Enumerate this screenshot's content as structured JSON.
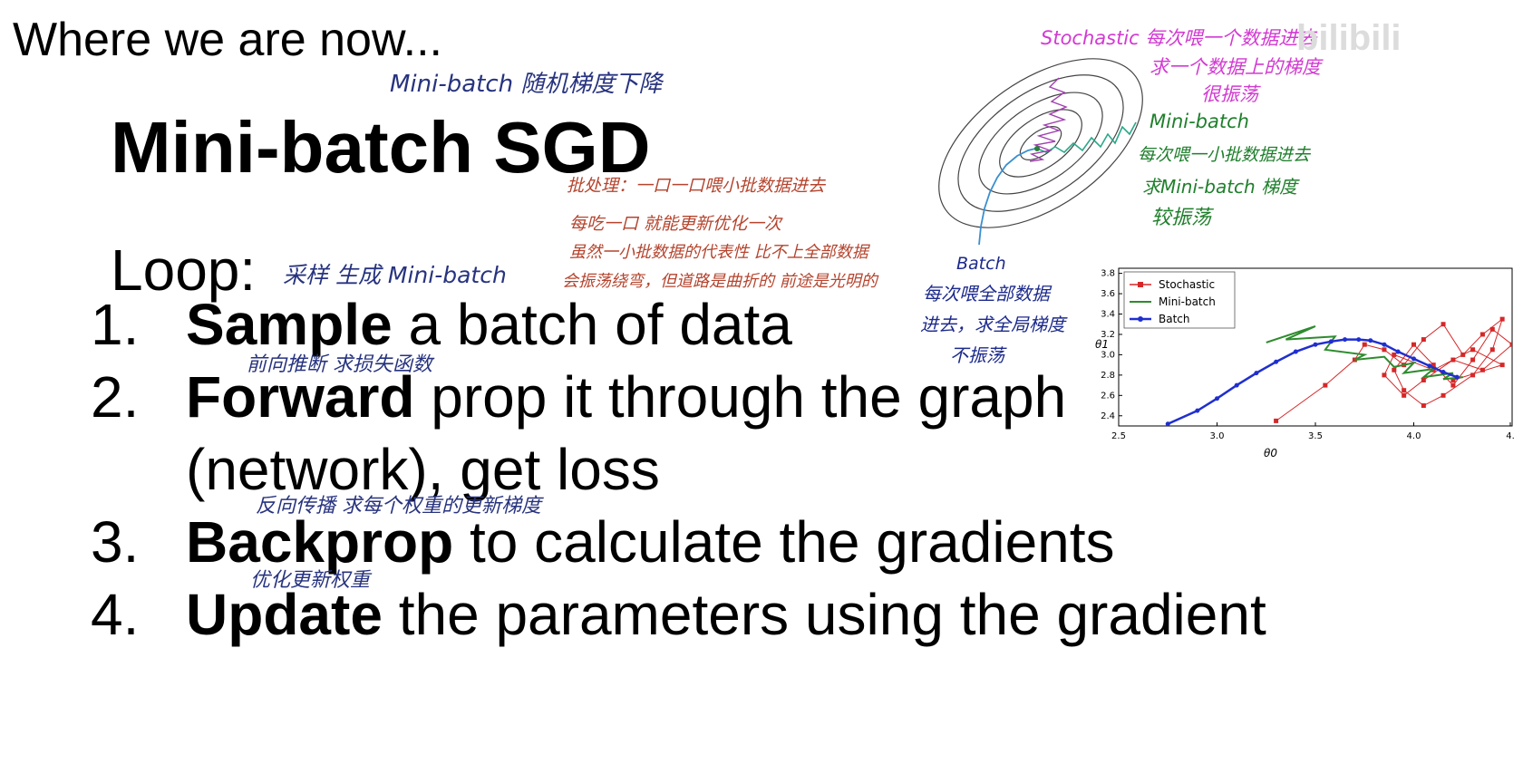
{
  "slide": {
    "header": "Where we are now...",
    "title": "Mini-batch SGD",
    "loop_label": "Loop:",
    "steps": [
      {
        "num": "1.",
        "bold": "Sample",
        "rest": " a batch of data"
      },
      {
        "num": "2.",
        "bold": "Forward",
        "rest": " prop it through the graph"
      },
      {
        "num": "",
        "bold": "",
        "rest": "(network), get loss"
      },
      {
        "num": "3.",
        "bold": "Backprop",
        "rest": " to calculate the gradients"
      },
      {
        "num": "4.",
        "bold": "Update",
        "rest": " the parameters using the gradient"
      }
    ]
  },
  "annotations": {
    "title_note": "Mini-batch 随机梯度下降",
    "red_1": "批处理：一口一口喂小批数据进去",
    "red_2": "每吃一口 就能更新优化一次",
    "red_3": "虽然一小批数据的代表性 比不上全部数据",
    "red_4": "会振荡绕弯，但道路是曲折的 前途是光明的",
    "sample_note": "采样 生成 Mini-batch",
    "forward_note": "前向推断 求损失函数",
    "backprop_note": "反向传播 求每个权重的更新梯度",
    "update_note": "优化更新权重",
    "stochastic_1": "Stochastic 每次喂一个数据进去",
    "stochastic_2": "求一个数据上的梯度",
    "stochastic_3": "很振荡",
    "minibatch_1": "Mini-batch",
    "minibatch_2": "每次喂一小批数据进去",
    "minibatch_3": "求Mini-batch 梯度",
    "minibatch_4": "较振荡",
    "batch_1": "Batch",
    "batch_2": "每次喂全部数据",
    "batch_3": "进去，求全局梯度",
    "batch_4": "不振荡"
  },
  "watermark": "bilibili",
  "chart_data": {
    "type": "line",
    "xlabel": "θ0",
    "ylabel": "θ1",
    "xlim": [
      2.5,
      4.5
    ],
    "ylim": [
      2.3,
      3.85
    ],
    "x_ticks": [
      "2.5",
      "3.0",
      "3.5",
      "4.0",
      "4."
    ],
    "y_ticks": [
      "2.4",
      "2.6",
      "2.8",
      "3.0",
      "3.2",
      "3.4",
      "3.6",
      "3.8"
    ],
    "legend_position": "top-left",
    "series": [
      {
        "name": "Stochastic",
        "color": "#d62728",
        "x": [
          3.3,
          3.55,
          3.7,
          3.75,
          3.85,
          3.95,
          4.05,
          4.15,
          4.25,
          4.35,
          4.45,
          4.4,
          4.3,
          4.15,
          4.05,
          3.95,
          3.9,
          4.0,
          4.1,
          4.2,
          4.3,
          4.4,
          4.5,
          4.35,
          4.2,
          4.05,
          3.95,
          3.85,
          3.9,
          4.1,
          4.3,
          4.45,
          4.2
        ],
        "y": [
          2.35,
          2.7,
          2.95,
          3.1,
          3.05,
          2.9,
          3.15,
          3.3,
          3.0,
          3.2,
          3.35,
          3.05,
          2.8,
          2.6,
          2.5,
          2.65,
          2.85,
          3.1,
          2.9,
          2.7,
          2.95,
          3.25,
          3.1,
          2.85,
          2.95,
          2.75,
          2.6,
          2.8,
          3.0,
          2.85,
          3.05,
          2.9,
          2.75
        ]
      },
      {
        "name": "Mini-batch",
        "color": "#2e8b2e",
        "x": [
          3.25,
          3.5,
          3.35,
          3.6,
          3.55,
          3.75,
          3.7,
          3.85,
          3.9,
          4.0,
          3.95,
          4.1,
          4.05,
          4.2,
          4.15,
          4.25
        ],
        "y": [
          3.12,
          3.28,
          3.15,
          3.18,
          3.05,
          3.0,
          2.95,
          2.98,
          2.88,
          2.92,
          2.82,
          2.86,
          2.78,
          2.82,
          2.76,
          2.78
        ]
      },
      {
        "name": "Batch",
        "color": "#1f2fcf",
        "x": [
          2.75,
          2.9,
          3.0,
          3.1,
          3.2,
          3.3,
          3.4,
          3.5,
          3.58,
          3.65,
          3.72,
          3.78,
          3.85,
          3.92,
          4.0,
          4.08,
          4.15,
          4.22
        ],
        "y": [
          2.32,
          2.45,
          2.57,
          2.7,
          2.82,
          2.93,
          3.03,
          3.1,
          3.13,
          3.15,
          3.15,
          3.14,
          3.1,
          3.03,
          2.96,
          2.89,
          2.83,
          2.78
        ]
      }
    ]
  }
}
